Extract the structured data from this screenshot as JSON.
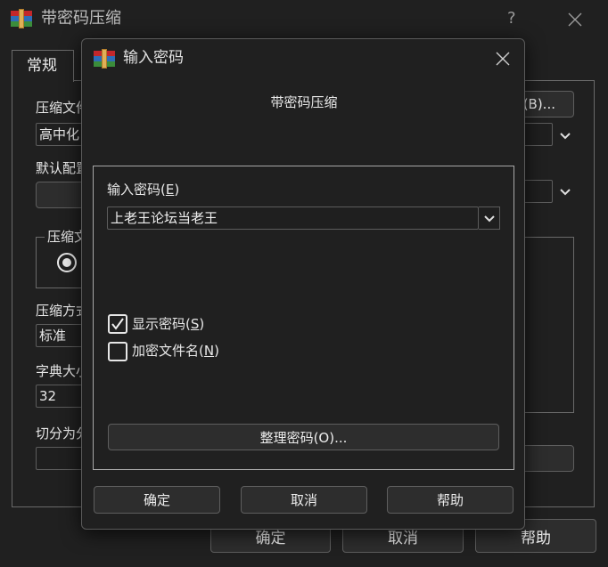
{
  "main_window": {
    "title": "带密码压缩",
    "help": "?",
    "tab_general": "常规",
    "archive_name_label": "压缩文件",
    "archive_name_value": "高中化",
    "browse_button_tail": "(B)...",
    "default_profile_label": "默认配置",
    "archive_format_label": "压缩文",
    "compression_method_label": "压缩方式",
    "compression_method_value": "标准",
    "dictionary_size_label": "字典大小",
    "dictionary_size_value": "32",
    "split_label": "切分为分",
    "ok": "确定",
    "cancel": "取消",
    "help_btn": "帮助"
  },
  "dialog": {
    "title": "输入密码",
    "subtitle": "带密码压缩",
    "password_label": "输入密码(",
    "password_label_key": "E",
    "password_label_end": ")",
    "password_value": "上老王论坛当老王",
    "show_password_label": "显示密码(",
    "show_password_key": "S",
    "show_password_end": ")",
    "show_password_checked": true,
    "encrypt_names_label": "加密文件名(",
    "encrypt_names_key": "N",
    "encrypt_names_end": ")",
    "encrypt_names_checked": false,
    "organize_button": "整理密码(O)...",
    "ok": "确定",
    "cancel": "取消",
    "help": "帮助"
  }
}
